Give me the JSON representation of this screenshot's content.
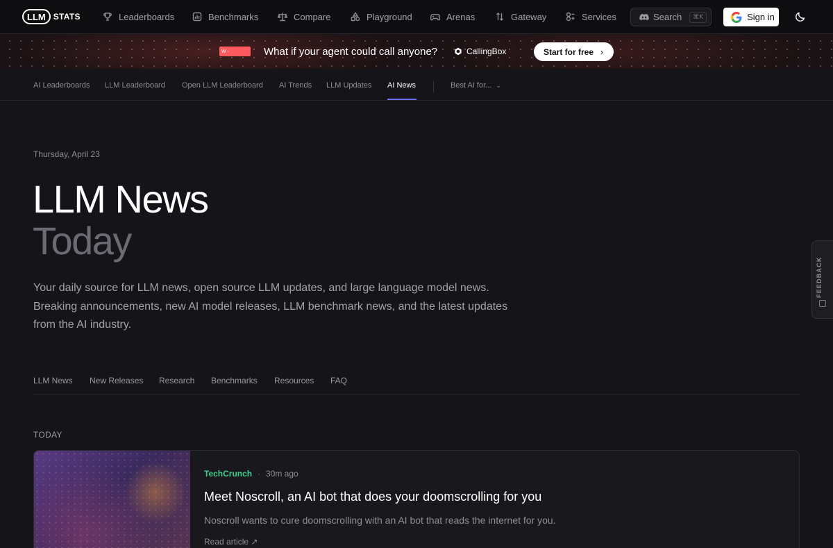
{
  "topnav": {
    "logo_llm": "LLM",
    "logo_stats": "STATS",
    "items": [
      {
        "label": "Leaderboards",
        "icon": "trophy-icon"
      },
      {
        "label": "Benchmarks",
        "icon": "bar-chart-icon"
      },
      {
        "label": "Compare",
        "icon": "scale-icon"
      },
      {
        "label": "Playground",
        "icon": "shapes-icon"
      },
      {
        "label": "Arenas",
        "icon": "gamepad-icon"
      },
      {
        "label": "Gateway",
        "icon": "arrows-icon"
      },
      {
        "label": "Services",
        "icon": "services-icon"
      }
    ],
    "search_label": "Search",
    "search_shortcut": "⌘K",
    "signin_label": "Sign in",
    "theme_icon": "moon-icon"
  },
  "banner": {
    "badge": "W ·",
    "headline": "What if your agent could call anyone?",
    "brand": "CallingBox",
    "cta": "Start for free",
    "accent": "#ff5a5f"
  },
  "subnav": {
    "items": [
      "AI Leaderboards",
      "LLM Leaderboard",
      "Open LLM Leaderboard",
      "AI Trends",
      "LLM Updates",
      "AI News"
    ],
    "active": "AI News",
    "dropdown": "Best AI for...",
    "accent": "#6e6ef0"
  },
  "hero": {
    "date": "Thursday, April 23",
    "title_line1": "LLM News",
    "title_line2": "Today",
    "intro": "Your daily source for LLM news, open source LLM updates, and large language model news. Breaking announcements, new AI model releases, LLM benchmark news, and the latest updates from the AI industry."
  },
  "tabs": [
    "LLM News",
    "New Releases",
    "Research",
    "Benchmarks",
    "Resources",
    "FAQ"
  ],
  "section_label": "TODAY",
  "article": {
    "source": "TechCrunch",
    "separator": "·",
    "time": "30m ago",
    "title": "Meet Noscroll, an AI bot that does your doomscrolling for you",
    "description": "Noscroll wants to cure doomscrolling with an AI bot that reads the internet for you.",
    "read_more": "Read article ↗",
    "source_color": "#3ecf8e"
  },
  "feedback": {
    "label": "FEEDBACK"
  }
}
